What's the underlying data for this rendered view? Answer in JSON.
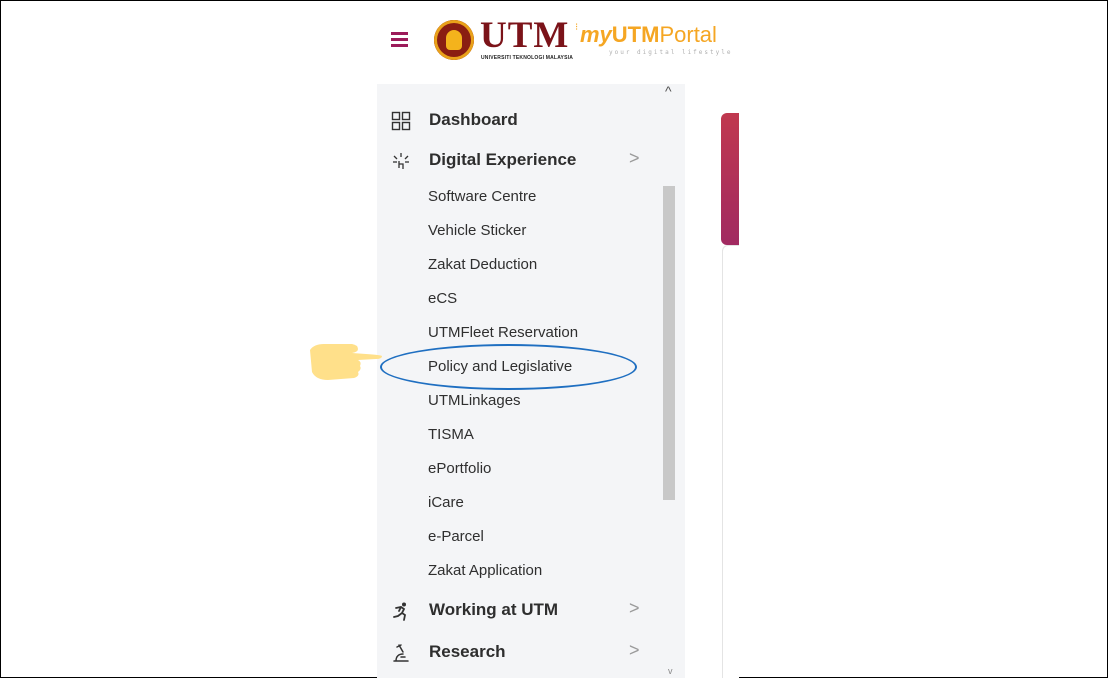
{
  "header": {
    "menu_icon": "hamburger-icon",
    "logo_main": "UTM",
    "logo_subtitle": "UNIVERSITI TEKNOLOGI MALAYSIA",
    "portal_logo": {
      "my": "my",
      "utm": "UTM",
      "portal": "Portal",
      "tagline": "your digital lifestyle"
    }
  },
  "sidebar": {
    "sections": [
      {
        "label": "Dashboard",
        "icon": "grid-icon",
        "has_chevron": false
      },
      {
        "label": "Digital Experience",
        "icon": "digital-sparkle-icon",
        "has_chevron": true,
        "chevron": ">"
      },
      {
        "label": "Working at UTM",
        "icon": "running-person-icon",
        "has_chevron": true,
        "chevron": ">"
      },
      {
        "label": "Research",
        "icon": "microscope-icon",
        "has_chevron": true,
        "chevron": ">"
      }
    ],
    "digital_experience_items": [
      "Software Centre",
      "Vehicle Sticker",
      "Zakat Deduction",
      "eCS",
      "UTMFleet Reservation",
      "Policy and Legislative",
      "UTMLinkages",
      "TISMA",
      "ePortfolio",
      "iCare",
      "e-Parcel",
      "Zakat Application"
    ],
    "scroll_up": "^",
    "scroll_down": "v"
  },
  "annotation": {
    "highlighted_item": "Policy and Legislative",
    "pointer_icon": "pointing-hand-icon",
    "ellipse_color": "#1f6fc1"
  },
  "colors": {
    "brand_maroon": "#7b1319",
    "accent_magenta": "#9c1b5a",
    "portal_orange": "#f5a623",
    "sidebar_bg": "#f4f5f7"
  }
}
